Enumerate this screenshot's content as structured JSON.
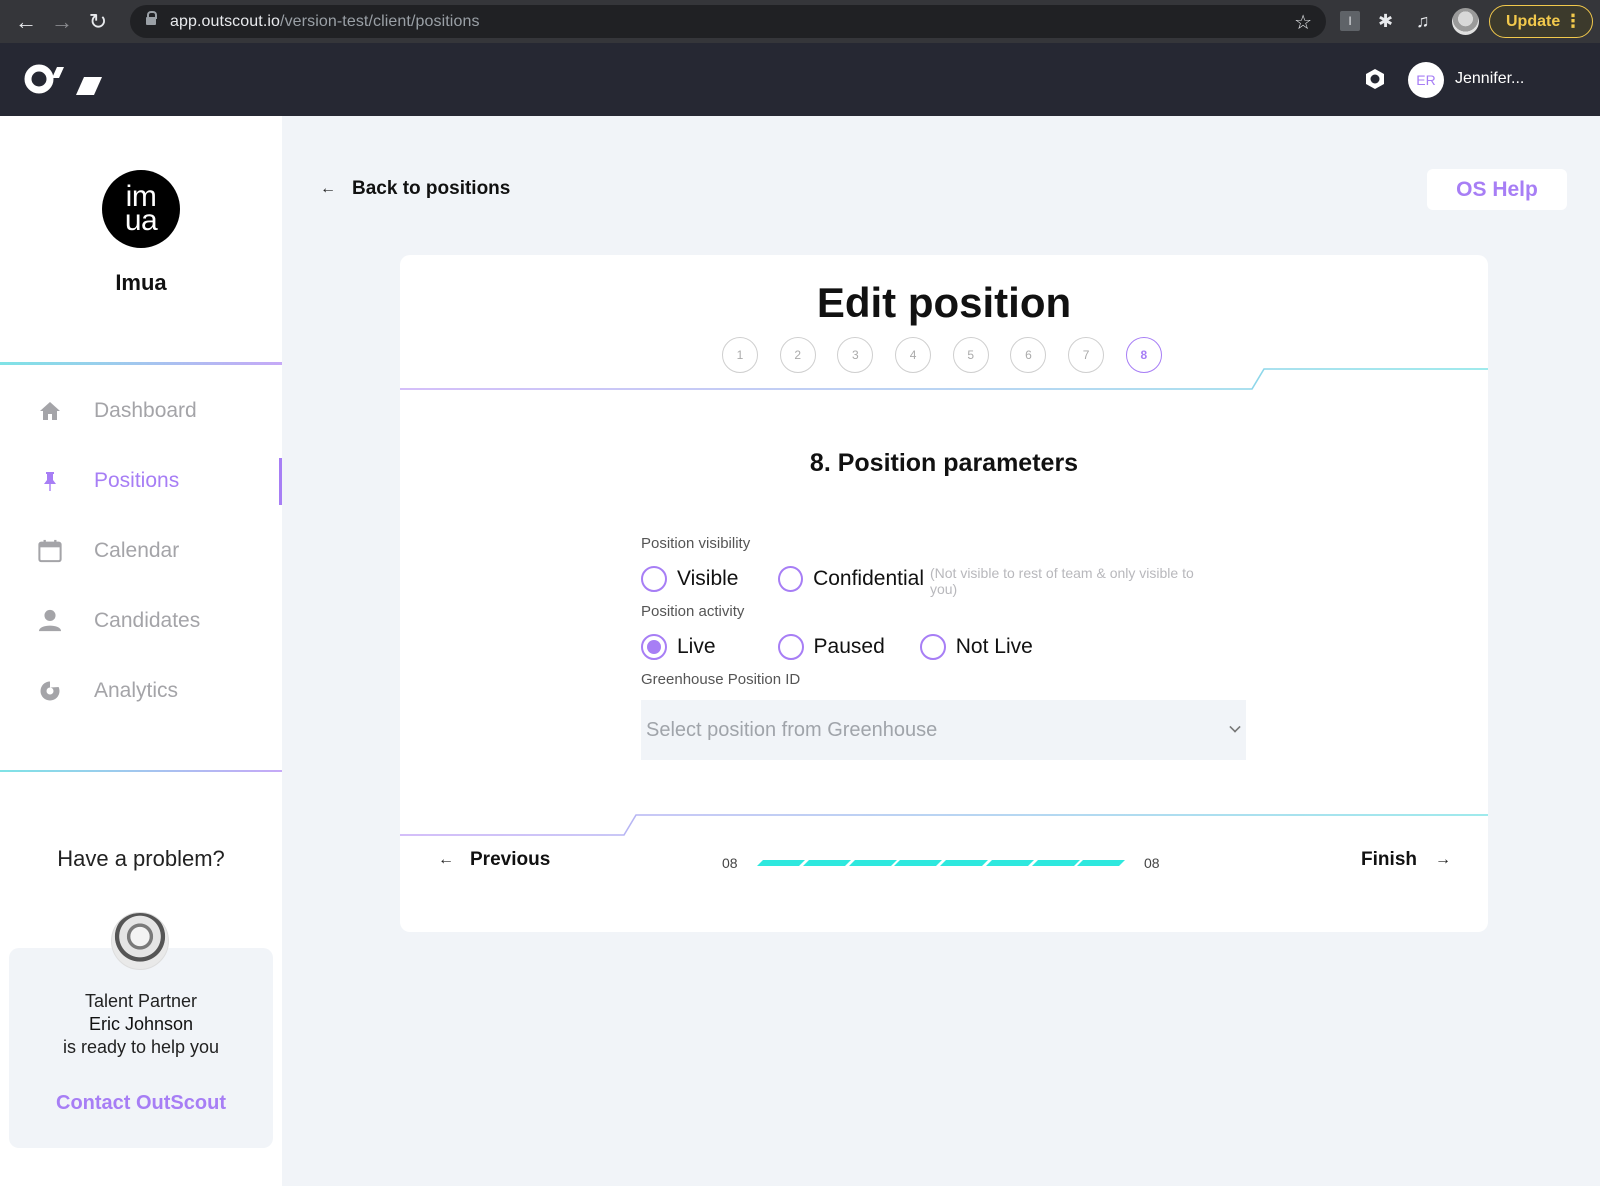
{
  "browser": {
    "url_host": "app.outscout.io",
    "url_path": "/version-test/client/positions",
    "update_label": "Update",
    "extension_label": "I"
  },
  "header": {
    "user_initials": "ER",
    "user_name": "Jennifer..."
  },
  "sidebar": {
    "company_logo_line1": "im",
    "company_logo_line2": "ua",
    "company_name": "Imua",
    "items": [
      {
        "label": "Dashboard",
        "icon": "home-icon",
        "active": false
      },
      {
        "label": "Positions",
        "icon": "pin-icon",
        "active": true
      },
      {
        "label": "Calendar",
        "icon": "calendar-icon",
        "active": false
      },
      {
        "label": "Candidates",
        "icon": "user-icon",
        "active": false
      },
      {
        "label": "Analytics",
        "icon": "pie-chart-icon",
        "active": false
      }
    ],
    "help": {
      "title": "Have a problem?",
      "role": "Talent Partner",
      "name": "Eric Johnson",
      "message": "is ready to help you",
      "contact_label": "Contact OutScout"
    }
  },
  "main": {
    "back_label": "Back to positions",
    "help_button": "OS Help",
    "card": {
      "title": "Edit position",
      "steps": [
        "1",
        "2",
        "3",
        "4",
        "5",
        "6",
        "7",
        "8"
      ],
      "current_step": 8,
      "section_title": "8. Position parameters",
      "visibility": {
        "label": "Position visibility",
        "options": [
          {
            "label": "Visible",
            "selected": false
          },
          {
            "label": "Confidential",
            "hint": "(Not visible to rest of team & only visible to you)",
            "selected": false
          }
        ]
      },
      "activity": {
        "label": "Position activity",
        "options": [
          {
            "label": "Live",
            "selected": true
          },
          {
            "label": "Paused",
            "selected": false
          },
          {
            "label": "Not Live",
            "selected": false
          }
        ]
      },
      "greenhouse": {
        "label": "Greenhouse Position ID",
        "placeholder": "Select position from Greenhouse",
        "value": ""
      },
      "footer": {
        "previous_label": "Previous",
        "finish_label": "Finish",
        "progress_current": "08",
        "progress_total": "08",
        "progress_fraction": 1.0,
        "progress_segments": 8
      }
    }
  },
  "colors": {
    "accent": "#a77ef5",
    "teal": "#2ee8de",
    "header_bg": "#262833",
    "page_bg": "#f1f4f8"
  }
}
